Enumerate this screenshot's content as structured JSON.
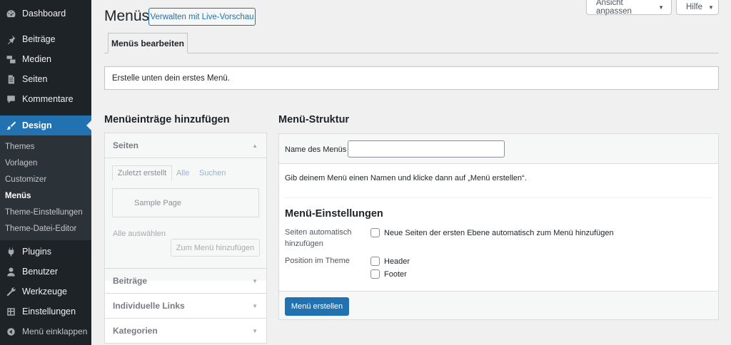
{
  "sidebar": {
    "items": [
      {
        "label": "Dashboard",
        "icon": "dashboard-icon"
      },
      {
        "label": "Beiträge",
        "icon": "pin-icon"
      },
      {
        "label": "Medien",
        "icon": "media-icon"
      },
      {
        "label": "Seiten",
        "icon": "pages-icon"
      },
      {
        "label": "Kommentare",
        "icon": "comment-icon"
      },
      {
        "label": "Design",
        "icon": "brush-icon"
      },
      {
        "label": "Plugins",
        "icon": "plugin-icon"
      },
      {
        "label": "Benutzer",
        "icon": "user-icon"
      },
      {
        "label": "Werkzeuge",
        "icon": "wrench-icon"
      },
      {
        "label": "Einstellungen",
        "icon": "settings-icon"
      }
    ],
    "submenu": [
      "Themes",
      "Vorlagen",
      "Customizer",
      "Menüs",
      "Theme-Einstellungen",
      "Theme-Datei-Editor"
    ],
    "collapse_label": "Menü einklappen"
  },
  "topbar": {
    "screen_options": "Ansicht anpassen",
    "help": "Hilfe"
  },
  "header": {
    "title": "Menüs",
    "live_preview": "Verwalten mit Live-Vorschau"
  },
  "tabs": {
    "edit": "Menüs bearbeiten"
  },
  "notice": "Erstelle unten dein erstes Menü.",
  "add_items": {
    "title": "Menüeinträge hinzufügen",
    "sections": [
      "Seiten",
      "Beiträge",
      "Individuelle Links",
      "Kategorien"
    ],
    "tabs": [
      "Zuletzt erstellt",
      "Alle",
      "Suchen"
    ],
    "page_item": "Sample Page",
    "select_all": "Alle auswählen",
    "add_button": "Zum Menü hinzufügen"
  },
  "structure": {
    "title": "Menü-Struktur",
    "name_label": "Name des Menüs",
    "name_value": "",
    "hint": "Gib deinem Menü einen Namen und klicke dann auf „Menü erstellen“.",
    "settings_title": "Menü-Einstellungen",
    "auto_add_label": "Seiten automatisch hinzufügen",
    "auto_add_option": "Neue Seiten der ersten Ebene automatisch zum Menü hinzufügen",
    "position_label": "Position im Theme",
    "positions": [
      "Header",
      "Footer"
    ],
    "create_button": "Menü erstellen"
  },
  "colors": {
    "sidebar_bg": "#1d2327",
    "accent": "#2271b1",
    "page_bg": "#f0f0f1"
  }
}
